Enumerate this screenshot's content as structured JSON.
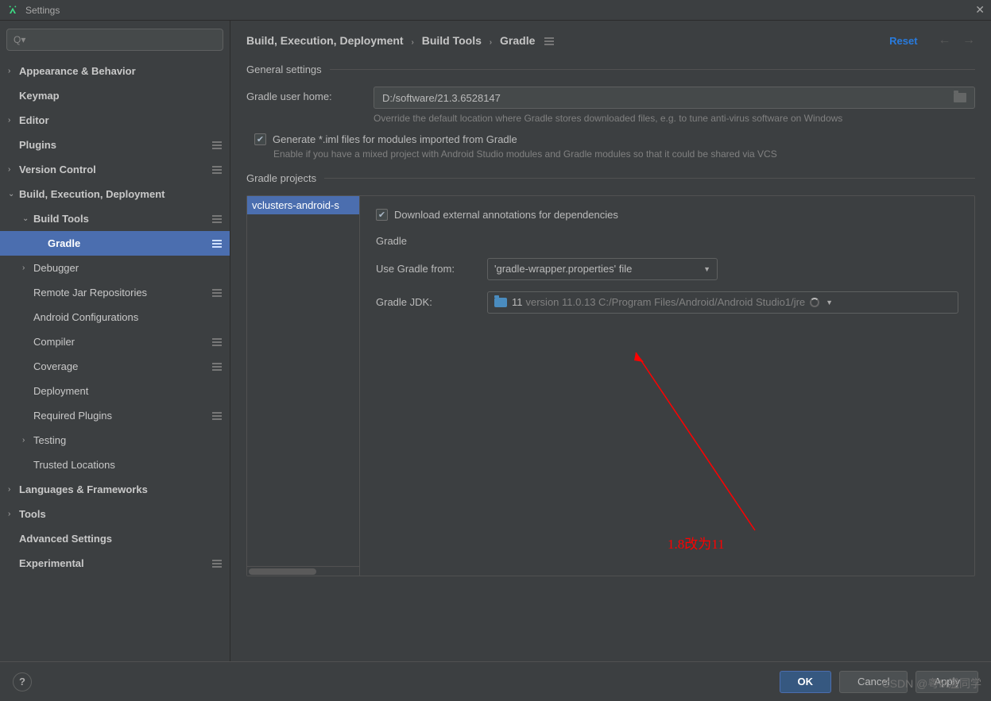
{
  "window": {
    "title": "Settings"
  },
  "search": {
    "placeholder": ""
  },
  "sidebar": {
    "items": [
      {
        "label": "Appearance & Behavior",
        "exp": "›",
        "bold": true,
        "indent": 0,
        "sep": false
      },
      {
        "label": "Keymap",
        "exp": "",
        "bold": true,
        "indent": 0,
        "sep": false
      },
      {
        "label": "Editor",
        "exp": "›",
        "bold": true,
        "indent": 0,
        "sep": false
      },
      {
        "label": "Plugins",
        "exp": "",
        "bold": true,
        "indent": 0,
        "sep": true
      },
      {
        "label": "Version Control",
        "exp": "›",
        "bold": true,
        "indent": 0,
        "sep": true
      },
      {
        "label": "Build, Execution, Deployment",
        "exp": "⌄",
        "bold": true,
        "indent": 0,
        "sep": false
      },
      {
        "label": "Build Tools",
        "exp": "⌄",
        "bold": true,
        "indent": 1,
        "sep": true
      },
      {
        "label": "Gradle",
        "exp": "",
        "bold": true,
        "indent": 2,
        "sep": true,
        "selected": true
      },
      {
        "label": "Debugger",
        "exp": "›",
        "bold": false,
        "indent": 1,
        "sep": false
      },
      {
        "label": "Remote Jar Repositories",
        "exp": "",
        "bold": false,
        "indent": 1,
        "sep": true
      },
      {
        "label": "Android Configurations",
        "exp": "",
        "bold": false,
        "indent": 1,
        "sep": false
      },
      {
        "label": "Compiler",
        "exp": "",
        "bold": false,
        "indent": 1,
        "sep": true
      },
      {
        "label": "Coverage",
        "exp": "",
        "bold": false,
        "indent": 1,
        "sep": true
      },
      {
        "label": "Deployment",
        "exp": "",
        "bold": false,
        "indent": 1,
        "sep": false
      },
      {
        "label": "Required Plugins",
        "exp": "",
        "bold": false,
        "indent": 1,
        "sep": true
      },
      {
        "label": "Testing",
        "exp": "›",
        "bold": false,
        "indent": 1,
        "sep": false
      },
      {
        "label": "Trusted Locations",
        "exp": "",
        "bold": false,
        "indent": 1,
        "sep": false
      },
      {
        "label": "Languages & Frameworks",
        "exp": "›",
        "bold": true,
        "indent": 0,
        "sep": false
      },
      {
        "label": "Tools",
        "exp": "›",
        "bold": true,
        "indent": 0,
        "sep": false
      },
      {
        "label": "Advanced Settings",
        "exp": "",
        "bold": true,
        "indent": 0,
        "sep": false
      },
      {
        "label": "Experimental",
        "exp": "",
        "bold": true,
        "indent": 0,
        "sep": true
      }
    ]
  },
  "breadcrumb": {
    "a": "Build, Execution, Deployment",
    "b": "Build Tools",
    "c": "Gradle"
  },
  "reset_label": "Reset",
  "sections": {
    "general": "General settings",
    "gradle_projects": "Gradle projects"
  },
  "gradle_home": {
    "label": "Gradle user home:",
    "value": "D:/software/21.3.6528147",
    "hint": "Override the default location where Gradle stores downloaded files, e.g. to tune anti-virus software on Windows"
  },
  "generate_iml": {
    "label": "Generate *.iml files for modules imported from Gradle",
    "hint": "Enable if you have a mixed project with Android Studio modules and Gradle modules so that it could be shared via VCS"
  },
  "project_item": "vclusters-android-s",
  "download_annotations": "Download external annotations for dependencies",
  "gradle_sub": "Gradle",
  "use_gradle_from": {
    "label": "Use Gradle from:",
    "value": "'gradle-wrapper.properties' file"
  },
  "gradle_jdk": {
    "label": "Gradle JDK:",
    "value": "11",
    "detail": "version 11.0.13 C:/Program Files/Android/Android Studio1/jre"
  },
  "annotation_text": "1.8改为11",
  "footer": {
    "ok": "OK",
    "cancel": "Cancel",
    "apply": "Apply"
  },
  "watermark": "CSDN @粤M温同学"
}
